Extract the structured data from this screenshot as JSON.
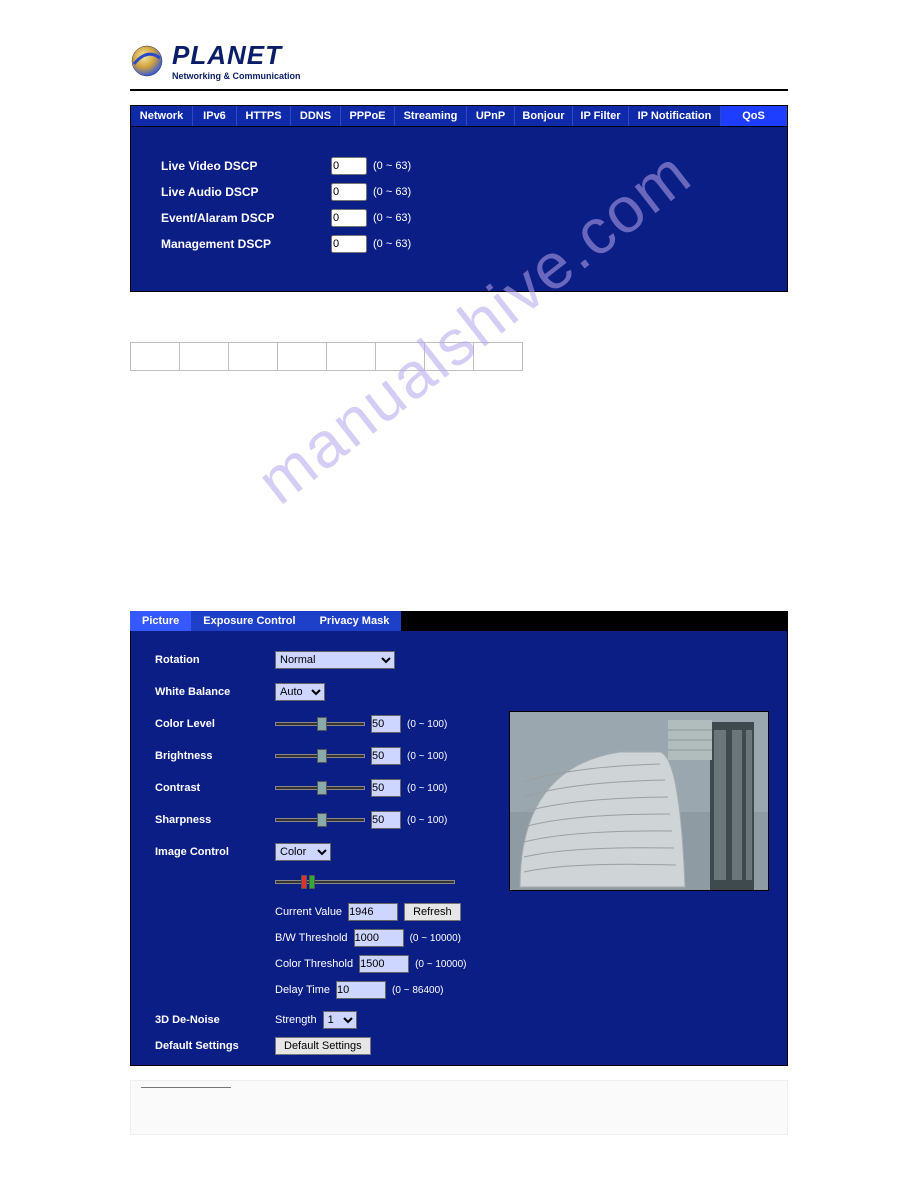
{
  "logo": {
    "name": "PLANET",
    "sub": "Networking & Communication"
  },
  "watermark_text": "manualshive.com",
  "nav": {
    "tabs": [
      {
        "label": "Network"
      },
      {
        "label": "IPv6"
      },
      {
        "label": "HTTPS"
      },
      {
        "label": "DDNS"
      },
      {
        "label": "PPPoE"
      },
      {
        "label": "Streaming"
      },
      {
        "label": "UPnP"
      },
      {
        "label": "Bonjour"
      },
      {
        "label": "IP Filter"
      },
      {
        "label": "IP Notification"
      },
      {
        "label": "QoS"
      }
    ],
    "active_index": 10
  },
  "dscp": {
    "rows": [
      {
        "label": "Live Video DSCP",
        "value": "0",
        "hint": "(0 ~ 63)"
      },
      {
        "label": "Live Audio DSCP",
        "value": "0",
        "hint": "(0 ~ 63)"
      },
      {
        "label": "Event/Alaram DSCP",
        "value": "0",
        "hint": "(0 ~ 63)"
      },
      {
        "label": "Management DSCP",
        "value": "0",
        "hint": "(0 ~ 63)"
      }
    ]
  },
  "pic_tabs": {
    "tabs": [
      {
        "label": "Picture"
      },
      {
        "label": "Exposure Control"
      },
      {
        "label": "Privacy Mask"
      }
    ],
    "active_index": 0
  },
  "picture": {
    "rotation_label": "Rotation",
    "rotation_value": "Normal",
    "wb_label": "White Balance",
    "wb_value": "Auto",
    "color_level_label": "Color Level",
    "color_level_value": "50",
    "brightness_label": "Brightness",
    "brightness_value": "50",
    "contrast_label": "Contrast",
    "contrast_value": "50",
    "sharpness_label": "Sharpness",
    "sharpness_value": "50",
    "slider_hint": "(0 ~ 100)",
    "image_control_label": "Image Control",
    "image_control_value": "Color",
    "current_value_label": "Current Value",
    "current_value": "1946",
    "refresh_label": "Refresh",
    "bw_thresh_label": "B/W Threshold",
    "bw_thresh_value": "1000",
    "color_thresh_label": "Color Threshold",
    "color_thresh_value": "1500",
    "thresh_hint": "(0 ~ 10000)",
    "delay_label": "Delay Time",
    "delay_value": "10",
    "delay_hint": "(0 ~ 86400)",
    "denoise_label": "3D De-Noise",
    "strength_label": "Strength",
    "strength_value": "1",
    "defaults_label": "Default Settings",
    "defaults_btn": "Default Settings"
  }
}
